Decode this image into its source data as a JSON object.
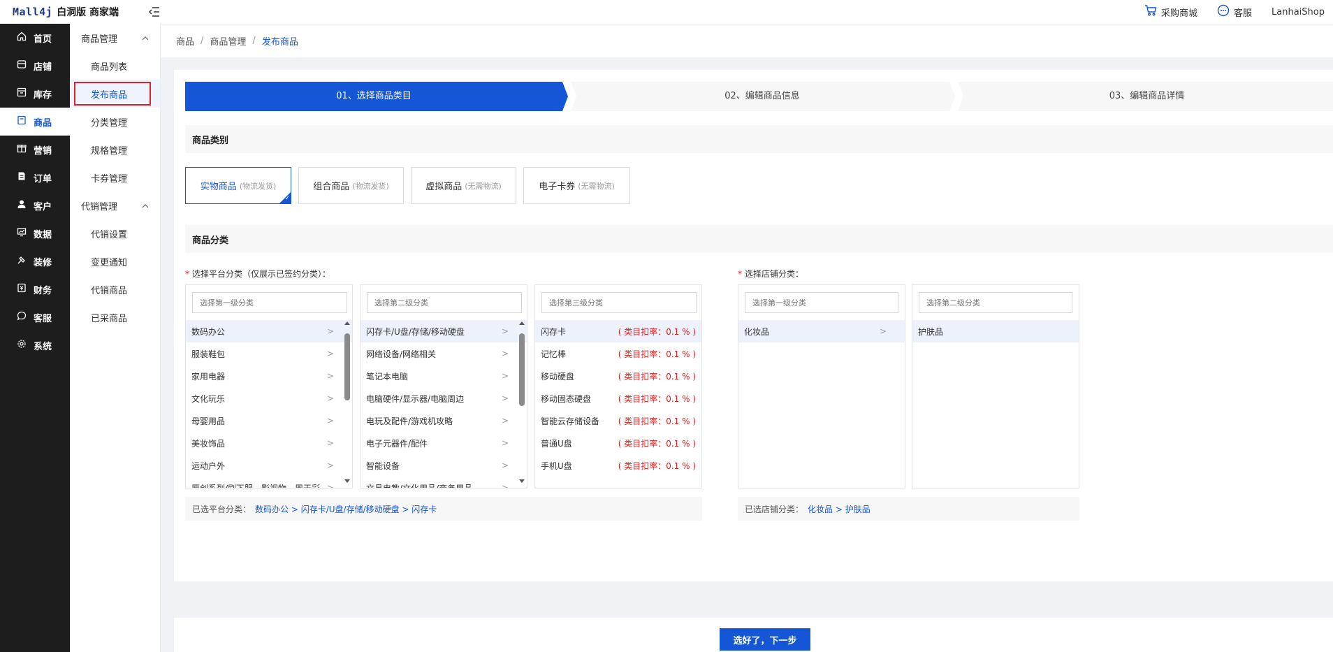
{
  "header": {
    "logo_mark": "Mall4j",
    "logo_text": "白洞版 商家端",
    "links": [
      {
        "label": "采购商城",
        "icon": "cart-icon"
      },
      {
        "label": "客服",
        "icon": "chat-icon"
      }
    ],
    "user": "LanhaiShop"
  },
  "sidebar": {
    "items": [
      {
        "label": "首页",
        "icon": "home-icon"
      },
      {
        "label": "店铺",
        "icon": "store-icon"
      },
      {
        "label": "库存",
        "icon": "inventory-icon"
      },
      {
        "label": "商品",
        "icon": "product-icon",
        "active": true
      },
      {
        "label": "营销",
        "icon": "gift-icon"
      },
      {
        "label": "订单",
        "icon": "order-icon"
      },
      {
        "label": "客户",
        "icon": "user-icon"
      },
      {
        "label": "数据",
        "icon": "data-icon"
      },
      {
        "label": "装修",
        "icon": "decorate-icon"
      },
      {
        "label": "财务",
        "icon": "finance-icon"
      },
      {
        "label": "客服",
        "icon": "service-icon"
      },
      {
        "label": "系统",
        "icon": "settings-icon"
      }
    ]
  },
  "submenu": {
    "group1": "商品管理",
    "group1_items": [
      "商品列表",
      "发布商品",
      "分类管理",
      "规格管理",
      "卡券管理"
    ],
    "group2": "代销管理",
    "group2_items": [
      "代销设置",
      "变更通知",
      "代销商品",
      "已采商品"
    ]
  },
  "breadcrumb": [
    "商品",
    "商品管理",
    "发布商品"
  ],
  "steps": [
    "01、选择商品类目",
    "02、编辑商品信息",
    "03、编辑商品详情"
  ],
  "section_type": "商品类别",
  "product_types": [
    {
      "label": "实物商品",
      "sub": "(物流发货)",
      "selected": true
    },
    {
      "label": "组合商品",
      "sub": "(物流发货)"
    },
    {
      "label": "虚拟商品",
      "sub": "(无需物流)"
    },
    {
      "label": "电子卡券",
      "sub": "(无需物流)"
    }
  ],
  "section_category": "商品分类",
  "platform": {
    "label": "选择平台分类（仅展示已签约分类）：",
    "level1_placeholder": "选择第一级分类",
    "level2_placeholder": "选择第二级分类",
    "level3_placeholder": "选择第三级分类",
    "level1": [
      "数码办公",
      "服装鞋包",
      "家用电器",
      "文化玩乐",
      "母婴用品",
      "美妆饰品",
      "运动户外",
      "原创系列/剧下服，影视物，周天彩"
    ],
    "level2": [
      "闪存卡/U盘/存储/移动硬盘",
      "网络设备/网络相关",
      "笔记本电脑",
      "电脑硬件/显示器/电脑周边",
      "电玩及配件/游戏机攻略",
      "电子元器件/配件",
      "智能设备",
      "文具电教/文化用品/商务用品"
    ],
    "level3": [
      {
        "name": "闪存卡",
        "rate": "( 类目扣率：0.1 % )"
      },
      {
        "name": "记忆棒",
        "rate": "( 类目扣率：0.1 % )"
      },
      {
        "name": "移动硬盘",
        "rate": "( 类目扣率：0.1 % )"
      },
      {
        "name": "移动固态硬盘",
        "rate": "( 类目扣率：0.1 % )"
      },
      {
        "name": "智能云存储设备",
        "rate": "( 类目扣率：0.1 % )"
      },
      {
        "name": "普通U盘",
        "rate": "( 类目扣率：0.1 % )"
      },
      {
        "name": "手机U盘",
        "rate": "( 类目扣率：0.1 % )"
      }
    ],
    "selected_label": "已选平台分类：",
    "selected_path": "数码办公 >  闪存卡/U盘/存储/移动硬盘 >  闪存卡"
  },
  "store": {
    "label": "选择店铺分类：",
    "level1_placeholder": "选择第一级分类",
    "level2_placeholder": "选择第二级分类",
    "level1": [
      "化妆品"
    ],
    "level2": [
      "护肤品"
    ],
    "selected_label": "已选店铺分类：",
    "selected_path": "化妆品 >  护肤品"
  },
  "next_button": "选好了，下一步",
  "colors": {
    "accent": "#1456d6",
    "sidebar": "#1d1d1d",
    "rate": "#e02020"
  }
}
